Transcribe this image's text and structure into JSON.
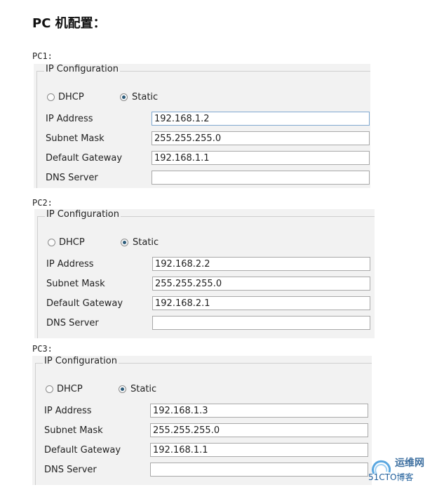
{
  "title": "PC 机配置：",
  "pcs": [
    {
      "label": "PC1:",
      "legend": "IP Configuration",
      "dhcp_label": "DHCP",
      "static_label": "Static",
      "selected": "static",
      "fields": [
        {
          "label": "IP Address",
          "value": "192.168.1.2"
        },
        {
          "label": "Subnet Mask",
          "value": "255.255.255.0"
        },
        {
          "label": "Default Gateway",
          "value": "192.168.1.1"
        },
        {
          "label": "DNS Server",
          "value": ""
        }
      ]
    },
    {
      "label": "PC2:",
      "legend": "IP Configuration",
      "dhcp_label": "DHCP",
      "static_label": "Static",
      "selected": "static",
      "fields": [
        {
          "label": "IP Address",
          "value": "192.168.2.2"
        },
        {
          "label": "Subnet Mask",
          "value": "255.255.255.0"
        },
        {
          "label": "Default Gateway",
          "value": "192.168.2.1"
        },
        {
          "label": "DNS Server",
          "value": ""
        }
      ]
    },
    {
      "label": "PC3:",
      "legend": "IP Configuration",
      "dhcp_label": "DHCP",
      "static_label": "Static",
      "selected": "static",
      "fields": [
        {
          "label": "IP Address",
          "value": "192.168.1.3"
        },
        {
          "label": "Subnet Mask",
          "value": "255.255.255.0"
        },
        {
          "label": "Default Gateway",
          "value": "192.168.1.1"
        },
        {
          "label": "DNS Server",
          "value": ""
        }
      ]
    }
  ],
  "watermark": {
    "site": "运维网",
    "brand": "51CTO博客"
  }
}
